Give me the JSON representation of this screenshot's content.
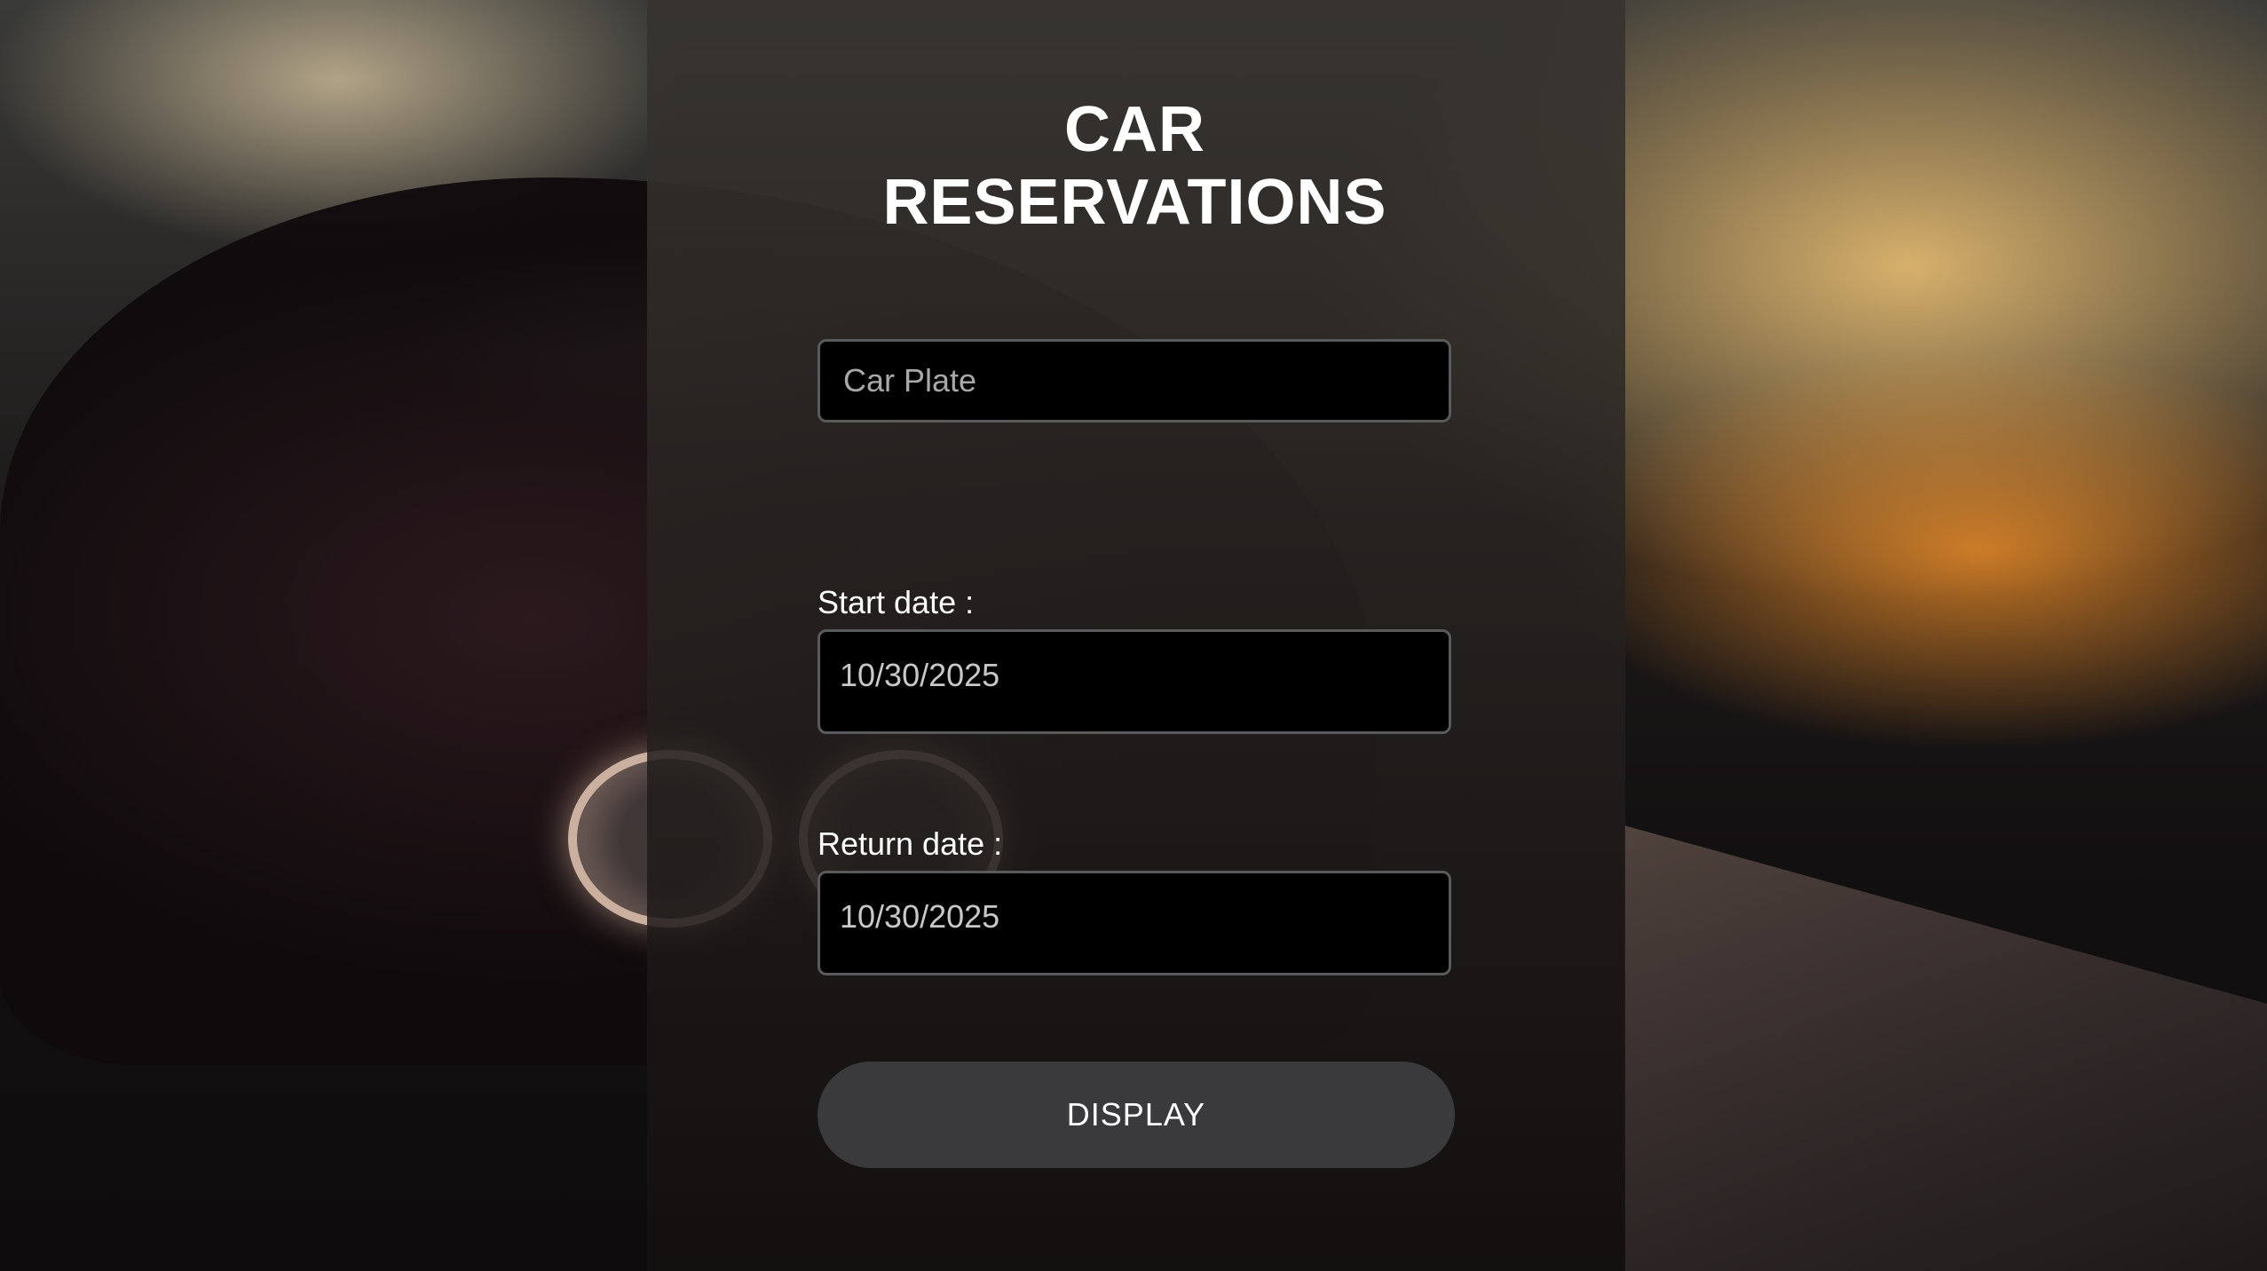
{
  "page": {
    "title": "CAR RESERVATIONS"
  },
  "form": {
    "car_plate": {
      "value": "",
      "placeholder": "Car Plate"
    },
    "start_date": {
      "label": "Start date :",
      "value": "10/30/2025"
    },
    "return_date": {
      "label": "Return date :",
      "value": "10/30/2025"
    },
    "display_button": {
      "label": "DISPLAY"
    }
  },
  "colors": {
    "panel": "#2f2c29",
    "input_bg": "#000000",
    "button_bg": "#3a3a3d",
    "text": "#ffffff"
  }
}
